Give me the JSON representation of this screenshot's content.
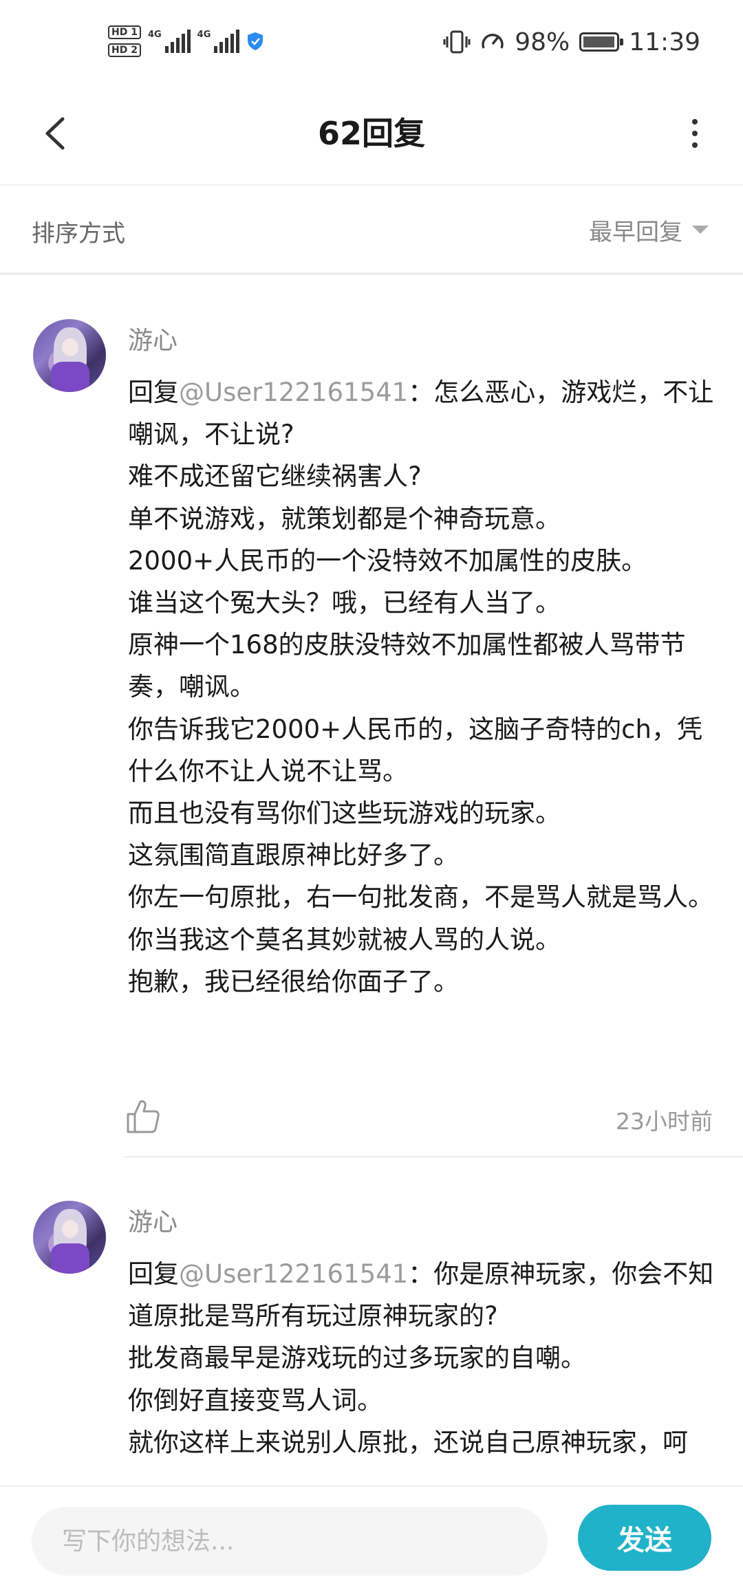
{
  "status_bar": {
    "sim1": "HD 1",
    "sim2": "HD 2",
    "network1": "4G",
    "network2": "4G",
    "battery": "98%",
    "battery_level": 0.98,
    "time": "11:39"
  },
  "header": {
    "title": "62回复",
    "back_icon": "chevron-left-icon",
    "more_icon": "more-vertical-icon"
  },
  "sort": {
    "label": "排序方式",
    "selected": "最早回复"
  },
  "replies": [
    {
      "username": "游心",
      "reply_prefix": "回复",
      "mention": "@User122161541",
      "lines": [
        "：怎么恶心，游戏烂，不让嘲讽，不让说?",
        "难不成还留它继续祸害人?",
        "单不说游戏，就策划都是个神奇玩意。",
        "2000+人民币的一个没特效不加属性的皮肤。",
        "谁当这个冤大头？哦，已经有人当了。",
        "原神一个168的皮肤没特效不加属性都被人骂带节奏，嘲讽。",
        "你告诉我它2000+人民币的，这脑子奇特的ch，凭什么你不让人说不让骂。",
        "而且也没有骂你们这些玩游戏的玩家。",
        "这氛围简直跟原神比好多了。",
        "你左一句原批，右一句批发商，不是骂人就是骂人。",
        "你当我这个莫名其妙就被人骂的人说。",
        "抱歉，我已经很给你面子了。"
      ],
      "time": "23小时前"
    },
    {
      "username": "游心",
      "reply_prefix": "回复",
      "mention": "@User122161541",
      "lines": [
        "：你是原神玩家，你会不知道原批是骂所有玩过原神玩家的?",
        "批发商最早是游戏玩的过多玩家的自嘲。",
        "你倒好直接变骂人词。",
        "就你这样上来说别人原批，还说自己原神玩家，呵"
      ],
      "time": ""
    }
  ],
  "composer": {
    "placeholder": "写下你的想法...",
    "send_label": "发送"
  },
  "colors": {
    "accent": "#20b2c8",
    "muted_text": "#8a8a8a"
  }
}
